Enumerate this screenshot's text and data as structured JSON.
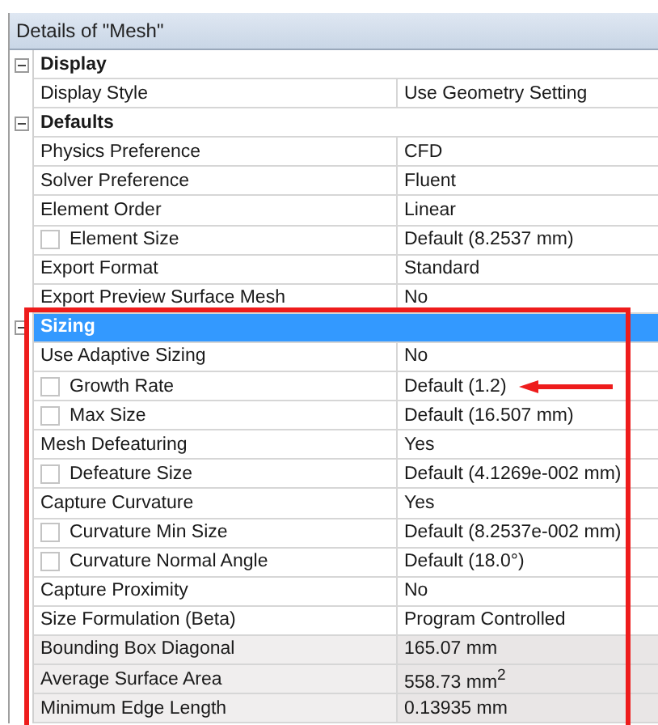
{
  "window": {
    "title": "Details of \"Mesh\""
  },
  "sections": [
    {
      "title": "Display",
      "expanded": true,
      "selected": false,
      "highlighted": false,
      "rows": [
        {
          "kind": "plain",
          "name": "Display Style",
          "value": "Use Geometry Setting",
          "read_only": false,
          "marked": false
        }
      ]
    },
    {
      "title": "Defaults",
      "expanded": true,
      "selected": false,
      "highlighted": false,
      "rows": [
        {
          "kind": "plain",
          "name": "Physics Preference",
          "value": "CFD",
          "read_only": false,
          "marked": false
        },
        {
          "kind": "plain",
          "name": "Solver Preference",
          "value": "Fluent",
          "read_only": false,
          "marked": false
        },
        {
          "kind": "plain",
          "name": "Element Order",
          "value": "Linear",
          "read_only": false,
          "marked": false
        },
        {
          "kind": "checkbox",
          "checked": false,
          "name": "Element Size",
          "value": "Default (8.2537 mm)",
          "read_only": false,
          "marked": false
        },
        {
          "kind": "plain",
          "name": "Export Format",
          "value": "Standard",
          "read_only": false,
          "marked": false
        },
        {
          "kind": "plain",
          "name": "Export Preview Surface Mesh",
          "value": "No",
          "read_only": false,
          "marked": false
        }
      ]
    },
    {
      "title": "Sizing",
      "expanded": true,
      "selected": true,
      "highlighted": true,
      "rows": [
        {
          "kind": "plain",
          "name": "Use Adaptive Sizing",
          "value": "No",
          "read_only": false,
          "marked": false
        },
        {
          "kind": "checkbox",
          "checked": false,
          "name": "Growth Rate",
          "value": "Default (1.2)",
          "read_only": false,
          "marked": true
        },
        {
          "kind": "checkbox",
          "checked": false,
          "name": "Max Size",
          "value": "Default (16.507 mm)",
          "read_only": false,
          "marked": false
        },
        {
          "kind": "plain",
          "name": "Mesh Defeaturing",
          "value": "Yes",
          "read_only": false,
          "marked": false
        },
        {
          "kind": "checkbox",
          "checked": false,
          "name": "Defeature Size",
          "value": "Default (4.1269e-002 mm)",
          "read_only": false,
          "marked": false
        },
        {
          "kind": "plain",
          "name": "Capture Curvature",
          "value": "Yes",
          "read_only": false,
          "marked": false
        },
        {
          "kind": "checkbox",
          "checked": false,
          "name": "Curvature Min Size",
          "value": "Default (8.2537e-002 mm)",
          "read_only": false,
          "marked": false
        },
        {
          "kind": "checkbox",
          "checked": false,
          "name": "Curvature Normal Angle",
          "value": "Default (18.0°)",
          "read_only": false,
          "marked": false
        },
        {
          "kind": "plain",
          "name": "Capture Proximity",
          "value": "No",
          "read_only": false,
          "marked": false
        },
        {
          "kind": "plain",
          "name": "Size Formulation (Beta)",
          "value": "Program Controlled",
          "read_only": false,
          "marked": false
        },
        {
          "kind": "plain",
          "name": "Bounding Box Diagonal",
          "value": "165.07 mm",
          "read_only": true,
          "marked": false
        },
        {
          "kind": "plain",
          "name": "Average Surface Area",
          "value": "558.73 mm$^{2}$",
          "read_only": true,
          "marked": false
        },
        {
          "kind": "plain",
          "name": "Minimum Edge Length",
          "value": "0.13935 mm",
          "read_only": true,
          "marked": false
        }
      ]
    }
  ]
}
